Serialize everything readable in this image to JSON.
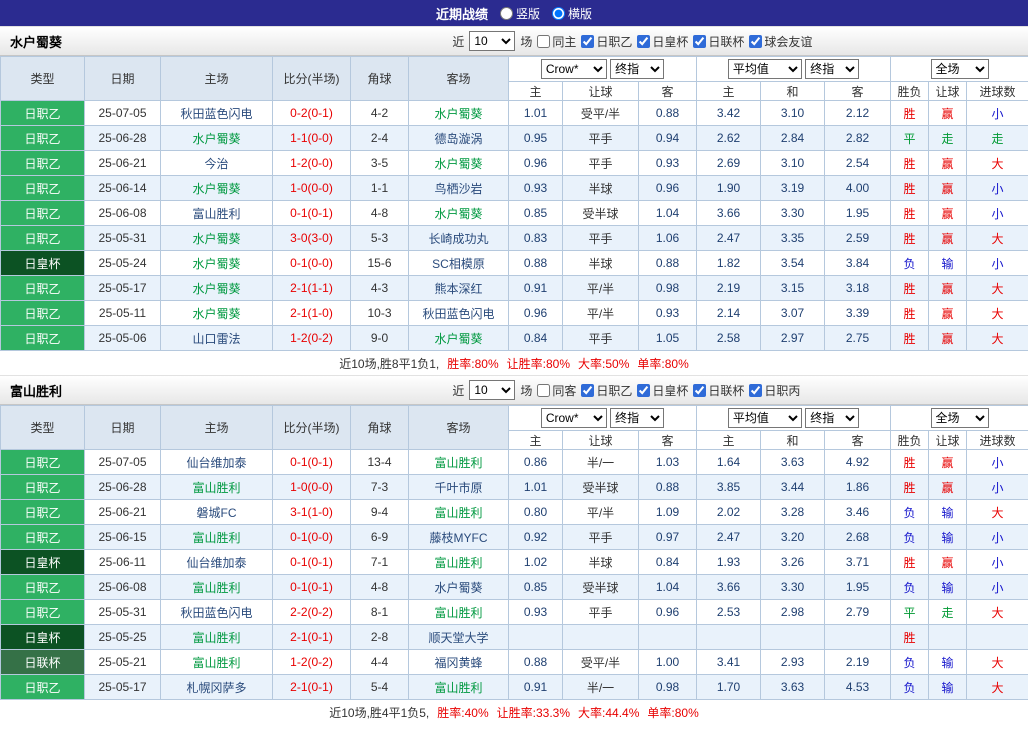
{
  "top_bar": {
    "title": "近期战绩",
    "vertical": "竖版",
    "horizontal": "横版",
    "horizontal_checked": "checked"
  },
  "labels": {
    "near": "近",
    "games": "场"
  },
  "selects": {
    "company": "Crow*",
    "final": "终指",
    "average": "平均值",
    "period": "全场"
  },
  "columns": {
    "type": "类型",
    "date": "日期",
    "home": "主场",
    "score": "比分(半场)",
    "corner": "角球",
    "away": "客场",
    "odds_home": "主",
    "handicap": "让球",
    "odds_away": "客",
    "avg_home": "主",
    "avg_draw": "和",
    "avg_away": "客",
    "result": "胜负",
    "handicap_result": "让球",
    "goals": "进球数"
  },
  "colors": {
    "accent": "#2b2b90",
    "win": "#e80000",
    "draw": "#009933",
    "lose": "#1414cc",
    "league_green": "#2fb163",
    "cup_dark_green": "#0c5223",
    "league_cup_green": "#357147",
    "focus_team": "#009940",
    "row_alt": "#e9f2fb",
    "border": "#b5c8dd"
  },
  "sections": [
    {
      "team": "水户蜀葵",
      "count": "10",
      "same_label": "同主",
      "leagues": [
        {
          "label": "日职乙",
          "checked": "checked"
        },
        {
          "label": "日皇杯",
          "checked": "checked"
        },
        {
          "label": "日联杯",
          "checked": "checked"
        },
        {
          "label": "球会友谊",
          "checked": "checked"
        }
      ],
      "rows": [
        {
          "league": "日职乙",
          "league_class": "lg-j2",
          "date": "25-07-05",
          "home": "秋田蓝色闪电",
          "score": "0-2(0-1)",
          "corner": "4-2",
          "away": "水户蜀葵",
          "away_class": "focus",
          "odds_home": "1.01",
          "handicap": "受平/半",
          "odds_away": "0.88",
          "avg_home": "3.42",
          "avg_draw": "3.10",
          "avg_away": "2.12",
          "result": "胜",
          "result_class": "r",
          "hresult": "赢",
          "hresult_class": "r",
          "goals": "小",
          "goals_class": "b"
        },
        {
          "league": "日职乙",
          "league_class": "lg-j2",
          "date": "25-06-28",
          "home": "水户蜀葵",
          "home_class": "focus",
          "score": "1-1(0-0)",
          "corner": "2-4",
          "away": "德岛漩涡",
          "odds_home": "0.95",
          "handicap": "平手",
          "odds_away": "0.94",
          "avg_home": "2.62",
          "avg_draw": "2.84",
          "avg_away": "2.82",
          "result": "平",
          "result_class": "g",
          "hresult": "走",
          "hresult_class": "g",
          "goals": "走",
          "goals_class": "g"
        },
        {
          "league": "日职乙",
          "league_class": "lg-j2",
          "date": "25-06-21",
          "home": "今治",
          "score": "1-2(0-0)",
          "corner": "3-5",
          "away": "水户蜀葵",
          "away_class": "focus",
          "odds_home": "0.96",
          "handicap": "平手",
          "odds_away": "0.93",
          "avg_home": "2.69",
          "avg_draw": "3.10",
          "avg_away": "2.54",
          "result": "胜",
          "result_class": "r",
          "hresult": "赢",
          "hresult_class": "r",
          "goals": "大",
          "goals_class": "r"
        },
        {
          "league": "日职乙",
          "league_class": "lg-j2",
          "date": "25-06-14",
          "home": "水户蜀葵",
          "home_class": "focus",
          "score": "1-0(0-0)",
          "corner": "1-1",
          "away": "鸟栖沙岩",
          "odds_home": "0.93",
          "handicap": "半球",
          "odds_away": "0.96",
          "avg_home": "1.90",
          "avg_draw": "3.19",
          "avg_away": "4.00",
          "result": "胜",
          "result_class": "r",
          "hresult": "赢",
          "hresult_class": "r",
          "goals": "小",
          "goals_class": "b"
        },
        {
          "league": "日职乙",
          "league_class": "lg-j2",
          "date": "25-06-08",
          "home": "富山胜利",
          "score": "0-1(0-1)",
          "corner": "4-8",
          "away": "水户蜀葵",
          "away_class": "focus",
          "odds_home": "0.85",
          "handicap": "受半球",
          "odds_away": "1.04",
          "avg_home": "3.66",
          "avg_draw": "3.30",
          "avg_away": "1.95",
          "result": "胜",
          "result_class": "r",
          "hresult": "赢",
          "hresult_class": "r",
          "goals": "小",
          "goals_class": "b"
        },
        {
          "league": "日职乙",
          "league_class": "lg-j2",
          "date": "25-05-31",
          "home": "水户蜀葵",
          "home_class": "focus",
          "score": "3-0(3-0)",
          "corner": "5-3",
          "away": "长崎成功丸",
          "odds_home": "0.83",
          "handicap": "平手",
          "odds_away": "1.06",
          "avg_home": "2.47",
          "avg_draw": "3.35",
          "avg_away": "2.59",
          "result": "胜",
          "result_class": "r",
          "hresult": "赢",
          "hresult_class": "r",
          "goals": "大",
          "goals_class": "r"
        },
        {
          "league": "日皇杯",
          "league_class": "lg-cup",
          "date": "25-05-24",
          "home": "水户蜀葵",
          "home_class": "focus",
          "score": "0-1(0-0)",
          "corner": "15-6",
          "away": "SC相模原",
          "odds_home": "0.88",
          "handicap": "半球",
          "odds_away": "0.88",
          "avg_home": "1.82",
          "avg_draw": "3.54",
          "avg_away": "3.84",
          "result": "负",
          "result_class": "b",
          "hresult": "输",
          "hresult_class": "b",
          "goals": "小",
          "goals_class": "b"
        },
        {
          "league": "日职乙",
          "league_class": "lg-j2",
          "date": "25-05-17",
          "home": "水户蜀葵",
          "home_class": "focus",
          "score": "2-1(1-1)",
          "corner": "4-3",
          "away": "熊本深红",
          "odds_home": "0.91",
          "handicap": "平/半",
          "odds_away": "0.98",
          "avg_home": "2.19",
          "avg_draw": "3.15",
          "avg_away": "3.18",
          "result": "胜",
          "result_class": "r",
          "hresult": "赢",
          "hresult_class": "r",
          "goals": "大",
          "goals_class": "r"
        },
        {
          "league": "日职乙",
          "league_class": "lg-j2",
          "date": "25-05-11",
          "home": "水户蜀葵",
          "home_class": "focus",
          "score": "2-1(1-0)",
          "corner": "10-3",
          "away": "秋田蓝色闪电",
          "odds_home": "0.96",
          "handicap": "平/半",
          "odds_away": "0.93",
          "avg_home": "2.14",
          "avg_draw": "3.07",
          "avg_away": "3.39",
          "result": "胜",
          "result_class": "r",
          "hresult": "赢",
          "hresult_class": "r",
          "goals": "大",
          "goals_class": "r"
        },
        {
          "league": "日职乙",
          "league_class": "lg-j2",
          "date": "25-05-06",
          "home": "山口雷法",
          "score": "1-2(0-2)",
          "corner": "9-0",
          "away": "水户蜀葵",
          "away_class": "focus",
          "odds_home": "0.84",
          "handicap": "平手",
          "odds_away": "1.05",
          "avg_home": "2.58",
          "avg_draw": "2.97",
          "avg_away": "2.75",
          "result": "胜",
          "result_class": "r",
          "hresult": "赢",
          "hresult_class": "r",
          "goals": "大",
          "goals_class": "r"
        }
      ],
      "footer": {
        "prefix": "近10场,胜8平1负1,",
        "stats": [
          {
            "label": "胜率:",
            "value": "80%"
          },
          {
            "label": "让胜率:",
            "value": "80%"
          },
          {
            "label": "大率:",
            "value": "50%"
          },
          {
            "label": "单率:",
            "value": "80%"
          }
        ]
      }
    },
    {
      "team": "富山胜利",
      "count": "10",
      "same_label": "同客",
      "leagues": [
        {
          "label": "日职乙",
          "checked": "checked"
        },
        {
          "label": "日皇杯",
          "checked": "checked"
        },
        {
          "label": "日联杯",
          "checked": "checked"
        },
        {
          "label": "日职丙",
          "checked": "checked"
        }
      ],
      "rows": [
        {
          "league": "日职乙",
          "league_class": "lg-j2",
          "date": "25-07-05",
          "home": "仙台维加泰",
          "score": "0-1(0-1)",
          "corner": "13-4",
          "away": "富山胜利",
          "away_class": "focus",
          "odds_home": "0.86",
          "handicap": "半/一",
          "odds_away": "1.03",
          "avg_home": "1.64",
          "avg_draw": "3.63",
          "avg_away": "4.92",
          "result": "胜",
          "result_class": "r",
          "hresult": "赢",
          "hresult_class": "r",
          "goals": "小",
          "goals_class": "b"
        },
        {
          "league": "日职乙",
          "league_class": "lg-j2",
          "date": "25-06-28",
          "home": "富山胜利",
          "home_class": "focus",
          "score": "1-0(0-0)",
          "corner": "7-3",
          "away": "千叶市原",
          "odds_home": "1.01",
          "handicap": "受半球",
          "odds_away": "0.88",
          "avg_home": "3.85",
          "avg_draw": "3.44",
          "avg_away": "1.86",
          "result": "胜",
          "result_class": "r",
          "hresult": "赢",
          "hresult_class": "r",
          "goals": "小",
          "goals_class": "b"
        },
        {
          "league": "日职乙",
          "league_class": "lg-j2",
          "date": "25-06-21",
          "home": "磐城FC",
          "score": "3-1(1-0)",
          "corner": "9-4",
          "away": "富山胜利",
          "away_class": "focus",
          "odds_home": "0.80",
          "handicap": "平/半",
          "odds_away": "1.09",
          "avg_home": "2.02",
          "avg_draw": "3.28",
          "avg_away": "3.46",
          "result": "负",
          "result_class": "b",
          "hresult": "输",
          "hresult_class": "b",
          "goals": "大",
          "goals_class": "r"
        },
        {
          "league": "日职乙",
          "league_class": "lg-j2",
          "date": "25-06-15",
          "home": "富山胜利",
          "home_class": "focus",
          "score": "0-1(0-0)",
          "corner": "6-9",
          "away": "藤枝MYFC",
          "odds_home": "0.92",
          "handicap": "平手",
          "odds_away": "0.97",
          "avg_home": "2.47",
          "avg_draw": "3.20",
          "avg_away": "2.68",
          "result": "负",
          "result_class": "b",
          "hresult": "输",
          "hresult_class": "b",
          "goals": "小",
          "goals_class": "b"
        },
        {
          "league": "日皇杯",
          "league_class": "lg-cup",
          "date": "25-06-11",
          "home": "仙台维加泰",
          "score": "0-1(0-1)",
          "corner": "7-1",
          "away": "富山胜利",
          "away_class": "focus",
          "odds_home": "1.02",
          "handicap": "半球",
          "odds_away": "0.84",
          "avg_home": "1.93",
          "avg_draw": "3.26",
          "avg_away": "3.71",
          "result": "胜",
          "result_class": "r",
          "hresult": "赢",
          "hresult_class": "r",
          "goals": "小",
          "goals_class": "b"
        },
        {
          "league": "日职乙",
          "league_class": "lg-j2",
          "date": "25-06-08",
          "home": "富山胜利",
          "home_class": "focus",
          "score": "0-1(0-1)",
          "corner": "4-8",
          "away": "水户蜀葵",
          "odds_home": "0.85",
          "handicap": "受半球",
          "odds_away": "1.04",
          "avg_home": "3.66",
          "avg_draw": "3.30",
          "avg_away": "1.95",
          "result": "负",
          "result_class": "b",
          "hresult": "输",
          "hresult_class": "b",
          "goals": "小",
          "goals_class": "b"
        },
        {
          "league": "日职乙",
          "league_class": "lg-j2",
          "date": "25-05-31",
          "home": "秋田蓝色闪电",
          "score": "2-2(0-2)",
          "corner": "8-1",
          "away": "富山胜利",
          "away_class": "focus",
          "odds_home": "0.93",
          "handicap": "平手",
          "odds_away": "0.96",
          "avg_home": "2.53",
          "avg_draw": "2.98",
          "avg_away": "2.79",
          "result": "平",
          "result_class": "g",
          "hresult": "走",
          "hresult_class": "g",
          "goals": "大",
          "goals_class": "r"
        },
        {
          "league": "日皇杯",
          "league_class": "lg-cup",
          "date": "25-05-25",
          "home": "富山胜利",
          "home_class": "focus",
          "score": "2-1(0-1)",
          "corner": "2-8",
          "away": "顺天堂大学",
          "odds_home": "",
          "handicap": "",
          "odds_away": "",
          "avg_home": "",
          "avg_draw": "",
          "avg_away": "",
          "result": "胜",
          "result_class": "r",
          "hresult": "",
          "goals": ""
        },
        {
          "league": "日联杯",
          "league_class": "lg-lc",
          "date": "25-05-21",
          "home": "富山胜利",
          "home_class": "focus",
          "score": "1-2(0-2)",
          "corner": "4-4",
          "away": "福冈黄蜂",
          "odds_home": "0.88",
          "handicap": "受平/半",
          "odds_away": "1.00",
          "avg_home": "3.41",
          "avg_draw": "2.93",
          "avg_away": "2.19",
          "result": "负",
          "result_class": "b",
          "hresult": "输",
          "hresult_class": "b",
          "goals": "大",
          "goals_class": "r"
        },
        {
          "league": "日职乙",
          "league_class": "lg-j2",
          "date": "25-05-17",
          "home": "札幌冈萨多",
          "score": "2-1(0-1)",
          "corner": "5-4",
          "away": "富山胜利",
          "away_class": "focus",
          "odds_home": "0.91",
          "handicap": "半/一",
          "odds_away": "0.98",
          "avg_home": "1.70",
          "avg_draw": "3.63",
          "avg_away": "4.53",
          "result": "负",
          "result_class": "b",
          "hresult": "输",
          "hresult_class": "b",
          "goals": "大",
          "goals_class": "r"
        }
      ],
      "footer": {
        "prefix": "近10场,胜4平1负5,",
        "stats": [
          {
            "label": "胜率:",
            "value": "40%"
          },
          {
            "label": "让胜率:",
            "value": "33.3%"
          },
          {
            "label": "大率:",
            "value": "44.4%"
          },
          {
            "label": "单率:",
            "value": "80%"
          }
        ]
      }
    }
  ]
}
